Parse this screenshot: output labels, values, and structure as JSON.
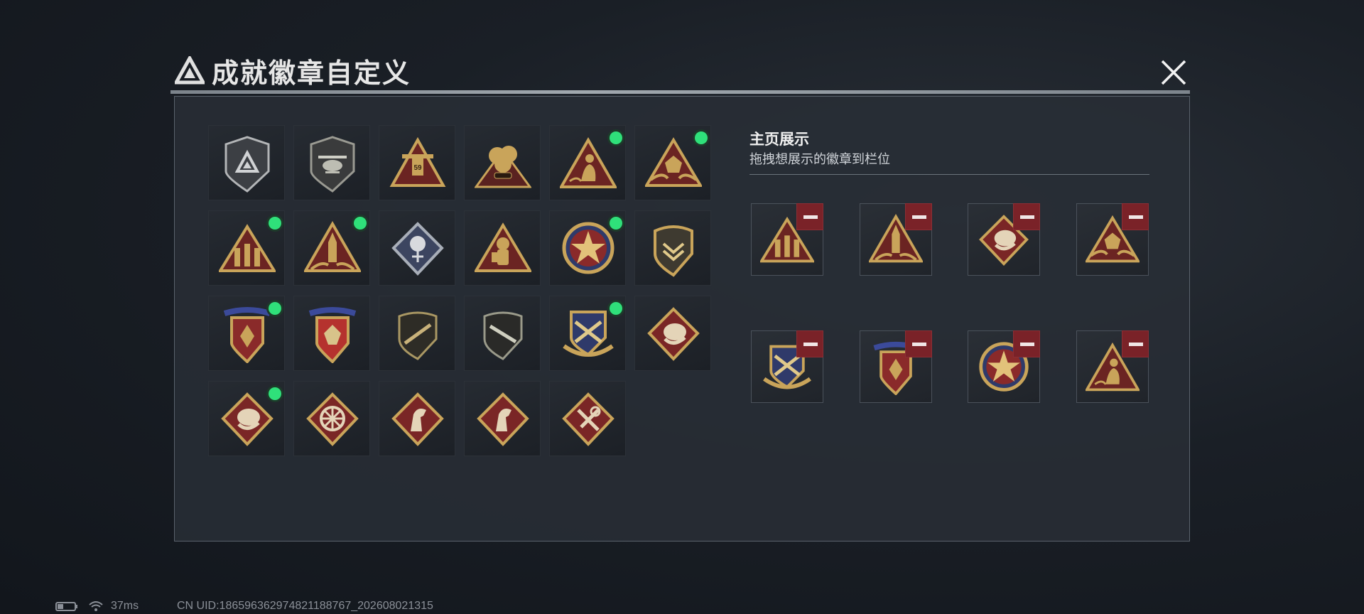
{
  "header": {
    "title": "成就徽章自定义"
  },
  "grid": {
    "badges": [
      {
        "icon": "plain-shield-badge-icon",
        "equipped": false
      },
      {
        "icon": "helicopter-shield-badge-icon",
        "equipped": false
      },
      {
        "icon": "tower-59-badge-icon",
        "equipped": false
      },
      {
        "icon": "explosion-badge-icon",
        "equipped": false
      },
      {
        "icon": "kneeling-soldier-badge-icon",
        "equipped": true
      },
      {
        "icon": "flower-triangle-badge-icon",
        "equipped": true
      },
      {
        "icon": "soldiers-triangle-badge-icon",
        "equipped": true
      },
      {
        "icon": "rocket-triangle-badge-icon",
        "equipped": true
      },
      {
        "icon": "rose-diamond-badge-icon",
        "equipped": false
      },
      {
        "icon": "astronaut-triangle-badge-icon",
        "equipped": false
      },
      {
        "icon": "star-round-badge-icon",
        "equipped": true
      },
      {
        "icon": "chevron-shield-badge-icon",
        "equipped": false
      },
      {
        "icon": "ribbon-shield-badge-icon",
        "equipped": true
      },
      {
        "icon": "ribbon-shield-red-badge-icon",
        "equipped": false
      },
      {
        "icon": "rifle-shield-badge-icon",
        "equipped": false
      },
      {
        "icon": "rifle-shield-dark-badge-icon",
        "equipped": false
      },
      {
        "icon": "crossed-arms-shield-badge-icon",
        "equipped": true
      },
      {
        "icon": "snake-diamond-badge-icon",
        "equipped": false
      },
      {
        "icon": "snake-diamond-badge-icon",
        "equipped": true
      },
      {
        "icon": "wheel-diamond-badge-icon",
        "equipped": false
      },
      {
        "icon": "horse-diamond-badge-icon",
        "equipped": false
      },
      {
        "icon": "horse-diamond-badge-icon",
        "equipped": false
      },
      {
        "icon": "tools-diamond-badge-icon",
        "equipped": false
      }
    ]
  },
  "panel": {
    "title": "主页展示",
    "subtitle": "拖拽想展示的徽章到栏位",
    "slots": [
      {
        "icon": "soldiers-triangle-badge-icon"
      },
      {
        "icon": "rocket-triangle-badge-icon"
      },
      {
        "icon": "snake-diamond-badge-icon"
      },
      {
        "icon": "flower-triangle-badge-icon"
      },
      {
        "icon": "crossed-arms-shield-badge-icon"
      },
      {
        "icon": "ribbon-shield-badge-icon"
      },
      {
        "icon": "star-round-badge-icon"
      },
      {
        "icon": "kneeling-soldier-badge-icon"
      }
    ]
  },
  "footer": {
    "latency": "37ms",
    "uid": "CN UID:18659636297482118876​7_202608021315"
  },
  "colors": {
    "equipped_dot": "#2fe07a",
    "remove_button": "#7a2228",
    "gold": "#c9a45a"
  }
}
